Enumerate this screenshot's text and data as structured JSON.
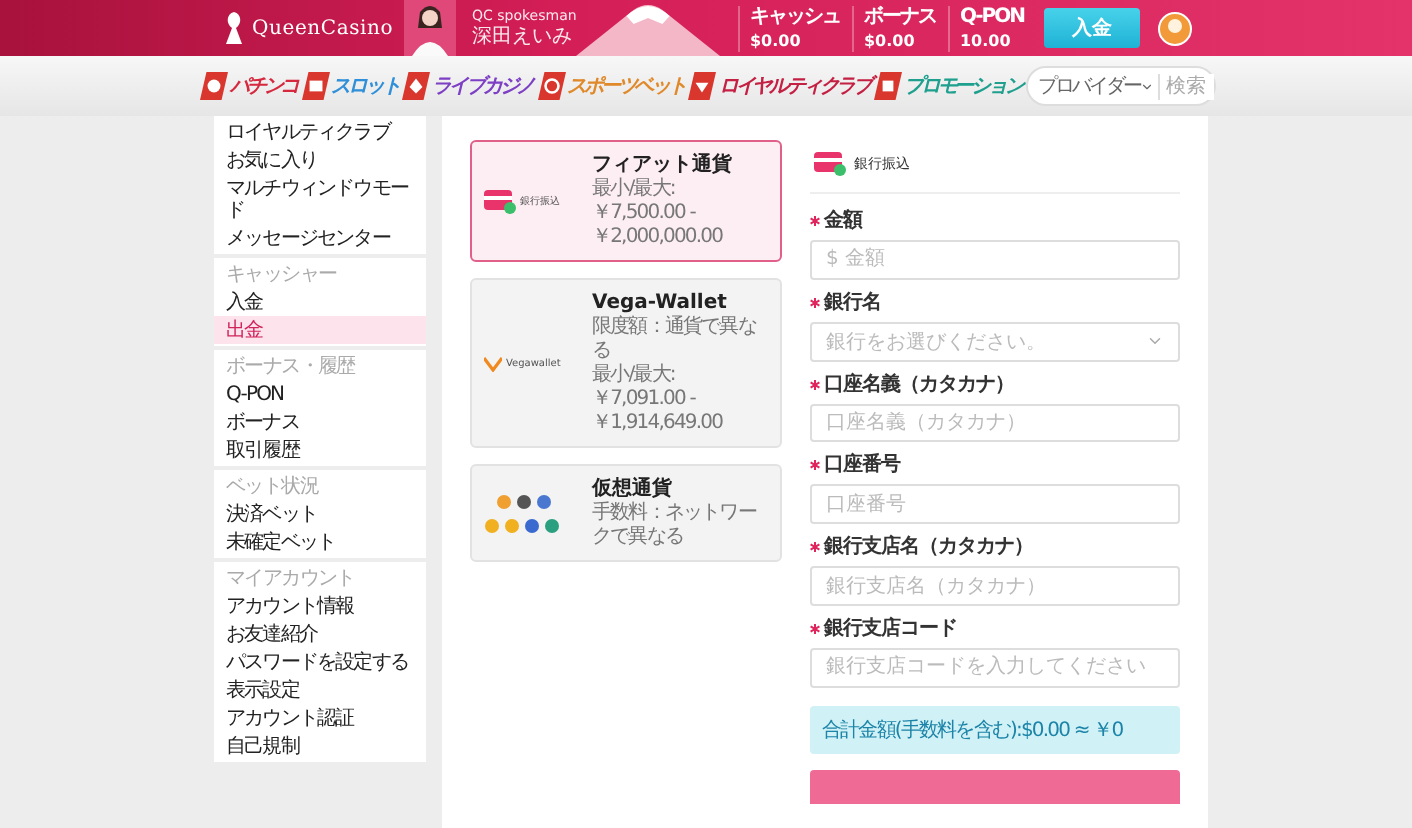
{
  "header": {
    "logo": "QueenCasino",
    "spokesman": {
      "title": "QC spokesman",
      "name": "深田えいみ"
    },
    "balances": [
      {
        "label": "キャッシュ",
        "value": "$0.00"
      },
      {
        "label": "ボーナス",
        "value": "$0.00"
      },
      {
        "label": "Q-PON",
        "value": "10.00"
      }
    ],
    "deposit_button": "入金"
  },
  "nav": {
    "items": [
      {
        "label": "パチンコ",
        "color": "#d6283e"
      },
      {
        "label": "スロット",
        "color": "#2f8fd8"
      },
      {
        "label": "ライブカジノ",
        "color": "#7d3fc4"
      },
      {
        "label": "スポーツベット",
        "color": "#e0892a"
      },
      {
        "label": "ロイヤルティクラブ",
        "color": "#c42044"
      },
      {
        "label": "プロモーション",
        "color": "#1fa08e"
      }
    ],
    "search": {
      "provider": "プロバイダー",
      "placeholder": "検索"
    }
  },
  "sidebar": {
    "sections": [
      {
        "items": [
          {
            "label": "ロイヤルティクラブ",
            "selected": false
          },
          {
            "label": "お気に入り",
            "selected": false
          },
          {
            "label": "マルチウィンドウモード",
            "selected": false
          },
          {
            "label": "メッセージセンター",
            "selected": false
          }
        ]
      },
      {
        "heading": "キャッシャー",
        "items": [
          {
            "label": "入金",
            "selected": false
          },
          {
            "label": "出金",
            "selected": true
          }
        ]
      },
      {
        "heading": "ボーナス・履歴",
        "items": [
          {
            "label": "Q-PON",
            "selected": false
          },
          {
            "label": "ボーナス",
            "selected": false
          },
          {
            "label": "取引履歴",
            "selected": false
          }
        ]
      },
      {
        "heading": "ベット状況",
        "items": [
          {
            "label": "決済ベット",
            "selected": false
          },
          {
            "label": "未確定ベット",
            "selected": false
          }
        ]
      },
      {
        "heading": "マイアカウント",
        "items": [
          {
            "label": "アカウント情報",
            "selected": false
          },
          {
            "label": "お友達紹介",
            "selected": false
          },
          {
            "label": "パスワードを設定する",
            "selected": false
          },
          {
            "label": "表示設定",
            "selected": false
          },
          {
            "label": "アカウント認証",
            "selected": false
          },
          {
            "label": "自己規制",
            "selected": false
          }
        ]
      }
    ]
  },
  "methods": [
    {
      "kind": "bank",
      "logo_text": "銀行振込",
      "title": "フィアット通貨",
      "lines": [
        "最小/最大: ￥7,500.00 - ￥2,000,000.00"
      ],
      "selected": true
    },
    {
      "kind": "wallet",
      "logo_text": "Vegawallet",
      "title": "Vega-Wallet",
      "lines": [
        "限度額：通貨で異なる",
        "最小/最大: ￥7,091.00 - ￥1,914,649.00"
      ],
      "selected": false
    },
    {
      "kind": "crypto",
      "title": "仮想通貨",
      "lines": [
        "手数料：ネットワークで異なる"
      ],
      "selected": false
    }
  ],
  "form": {
    "method_label": "銀行振込",
    "fields": [
      {
        "kind": "text",
        "label": "金額",
        "placeholder": "$ 金額",
        "required": true
      },
      {
        "kind": "select",
        "label": "銀行名",
        "placeholder": "銀行をお選びください。",
        "required": true
      },
      {
        "kind": "text",
        "label": "口座名義（カタカナ）",
        "placeholder": "口座名義（カタカナ）",
        "required": true
      },
      {
        "kind": "text",
        "label": "口座番号",
        "placeholder": "口座番号",
        "required": true
      },
      {
        "kind": "text",
        "label": "銀行支店名（カタカナ）",
        "placeholder": "銀行支店名（カタカナ）",
        "required": true
      },
      {
        "kind": "text",
        "label": "銀行支店コード",
        "placeholder": "銀行支店コードを入力してください",
        "required": true
      }
    ],
    "summary": "合計金額(手数料を含む):$0.00 ≈ ￥0"
  }
}
